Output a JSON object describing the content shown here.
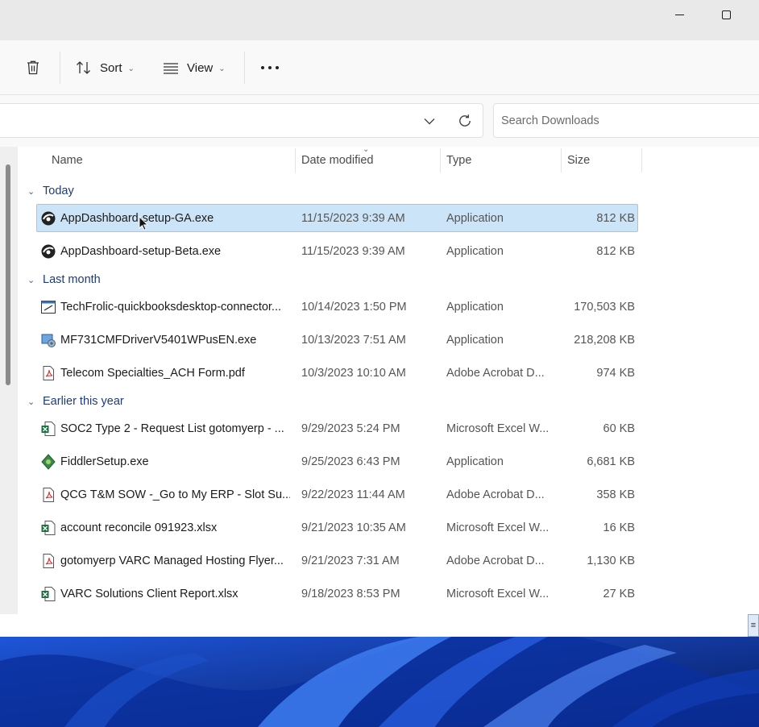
{
  "toolbar": {
    "sort_label": "Sort",
    "view_label": "View"
  },
  "search": {
    "placeholder": "Search Downloads"
  },
  "columns": {
    "name": "Name",
    "date": "Date modified",
    "type": "Type",
    "size": "Size"
  },
  "groups": [
    {
      "label": "Today",
      "rows": [
        {
          "name": "AppDashboard-setup-GA.exe",
          "date": "11/15/2023 9:39 AM",
          "type": "Application",
          "size": "812 KB",
          "icon": "app-installer-icon",
          "selected": true
        },
        {
          "name": "AppDashboard-setup-Beta.exe",
          "date": "11/15/2023 9:39 AM",
          "type": "Application",
          "size": "812 KB",
          "icon": "app-installer-icon"
        }
      ]
    },
    {
      "label": "Last month",
      "rows": [
        {
          "name": "TechFrolic-quickbooksdesktop-connector...",
          "date": "10/14/2023 1:50 PM",
          "type": "Application",
          "size": "170,503 KB",
          "icon": "setup-exe-icon"
        },
        {
          "name": "MF731CMFDriverV5401WPusEN.exe",
          "date": "10/13/2023 7:51 AM",
          "type": "Application",
          "size": "218,208 KB",
          "icon": "driver-setup-icon"
        },
        {
          "name": "Telecom Specialties_ACH Form.pdf",
          "date": "10/3/2023 10:10 AM",
          "type": "Adobe Acrobat D...",
          "size": "974 KB",
          "icon": "pdf-icon"
        }
      ]
    },
    {
      "label": "Earlier this year",
      "rows": [
        {
          "name": "SOC2 Type 2 - Request List gotomyerp - ...",
          "date": "9/29/2023 5:24 PM",
          "type": "Microsoft Excel W...",
          "size": "60 KB",
          "icon": "excel-icon"
        },
        {
          "name": "FiddlerSetup.exe",
          "date": "9/25/2023 6:43 PM",
          "type": "Application",
          "size": "6,681 KB",
          "icon": "fiddler-icon"
        },
        {
          "name": "QCG T&M SOW -_Go to My ERP - Slot Su...",
          "date": "9/22/2023 11:44 AM",
          "type": "Adobe Acrobat D...",
          "size": "358 KB",
          "icon": "pdf-icon"
        },
        {
          "name": "account reconcile 091923.xlsx",
          "date": "9/21/2023 10:35 AM",
          "type": "Microsoft Excel W...",
          "size": "16 KB",
          "icon": "excel-icon"
        },
        {
          "name": "gotomyerp VARC Managed Hosting Flyer...",
          "date": "9/21/2023 7:31 AM",
          "type": "Adobe Acrobat D...",
          "size": "1,130 KB",
          "icon": "pdf-icon"
        },
        {
          "name": "VARC Solutions Client Report.xlsx",
          "date": "9/18/2023 8:53 PM",
          "type": "Microsoft Excel W...",
          "size": "27 KB",
          "icon": "excel-icon"
        }
      ]
    }
  ],
  "colors": {
    "selection_bg": "#cce4f7",
    "selection_border": "#99c9ef",
    "group_header": "#1f3b7a",
    "desktop_blue": "#0c2a8a"
  }
}
